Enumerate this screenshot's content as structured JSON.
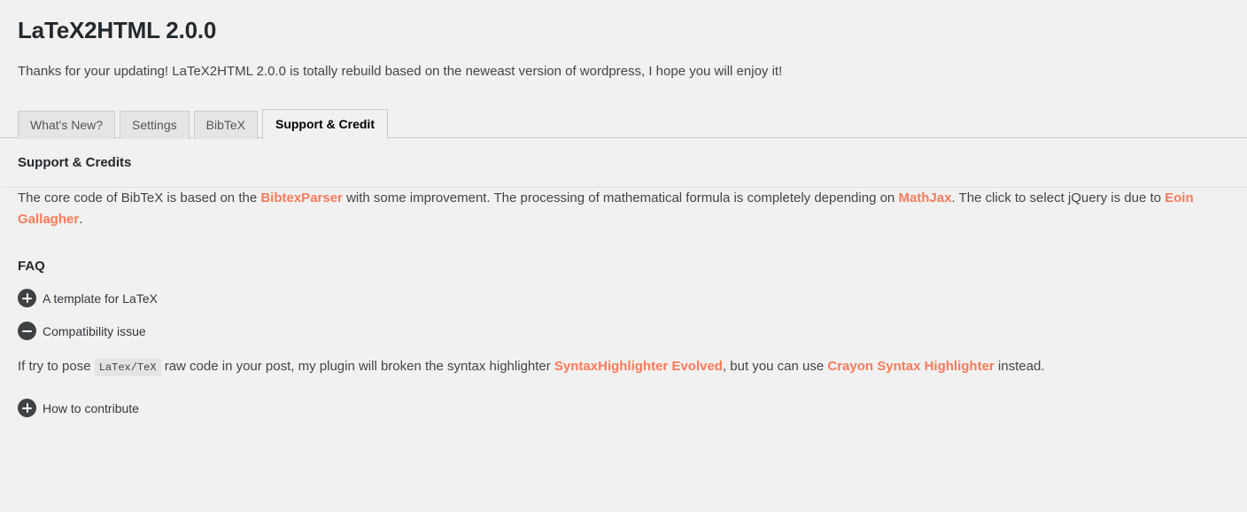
{
  "page": {
    "title": "LaTeX2HTML 2.0.0",
    "intro": "Thanks for your updating! LaTeX2HTML 2.0.0 is totally rebuild based on the neweast version of wordpress, I hope you will enjoy it!",
    "background_color": "#f1f1f1",
    "link_color": "#fb7a5a",
    "heading_color": "#23282d"
  },
  "tabs": [
    {
      "label": "What's New?",
      "active": false
    },
    {
      "label": "Settings",
      "active": false
    },
    {
      "label": "BibTeX",
      "active": false
    },
    {
      "label": "Support & Credit",
      "active": true
    }
  ],
  "section": {
    "title": "Support & Credits",
    "credit_paragraph": {
      "part1": "The core code of BibTeX is based on the ",
      "link1": "BibtexParser",
      "part2": " with some improvement. The processing of mathematical formula is completely depending on ",
      "link2": "MathJax",
      "part3": ". The click to select jQuery is due to ",
      "link3": "Eoin Gallagher",
      "part4": "."
    }
  },
  "faq": {
    "title": "FAQ",
    "items": [
      {
        "label": "A template for LaTeX",
        "icon": "plus-circle-icon",
        "expanded": false
      },
      {
        "label": "Compatibility issue",
        "icon": "minus-circle-icon",
        "expanded": true
      },
      {
        "label": "How to contribute",
        "icon": "plus-circle-icon",
        "expanded": false
      }
    ],
    "compatibility_answer": {
      "part1": "If try to pose ",
      "code": "LaTex/TeX",
      "part2": " raw code in your post, my plugin will broken the syntax highlighter ",
      "link1": "SyntaxHighlighter Evolved",
      "part3": ", but you can use ",
      "link2": "Crayon Syntax Highlighter",
      "part4": " instead."
    }
  }
}
